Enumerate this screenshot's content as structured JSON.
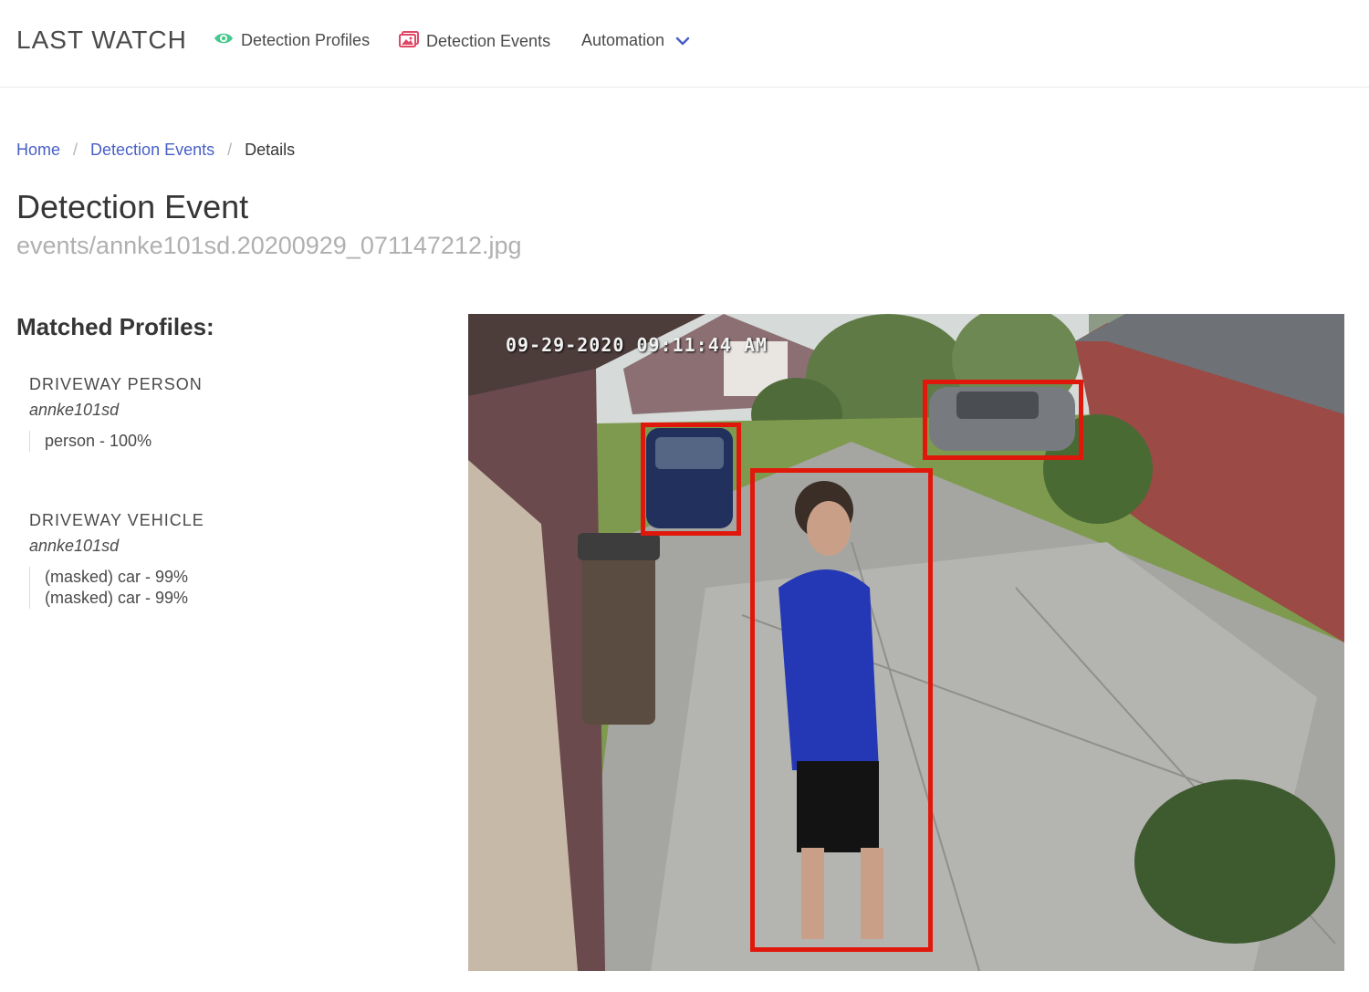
{
  "navbar": {
    "brand": "LAST WATCH",
    "items": [
      {
        "label": "Detection Profiles",
        "icon": "eye-icon",
        "color": "#48c78e"
      },
      {
        "label": "Detection Events",
        "icon": "image-gallery-icon",
        "color": "#e04865"
      },
      {
        "label": "Automation",
        "icon": "chevron-down-icon",
        "color": "#485fc7"
      }
    ]
  },
  "breadcrumb": {
    "home": "Home",
    "events": "Detection Events",
    "current": "Details",
    "separator": "/"
  },
  "page": {
    "title": "Detection Event",
    "subtitle": "events/annke101sd.20200929_071147212.jpg"
  },
  "matched": {
    "heading": "Matched Profiles:",
    "profiles": [
      {
        "name": "DRIVEWAY PERSON",
        "camera": "annke101sd",
        "matches": [
          "person - 100%"
        ]
      },
      {
        "name": "DRIVEWAY VEHICLE",
        "camera": "annke101sd",
        "matches": [
          "(masked) car - 99%",
          "(masked) car - 99%"
        ]
      }
    ]
  },
  "snapshot": {
    "timestamp": "09-29-2020 09:11:44 AM",
    "box_color": "#e0180c"
  }
}
